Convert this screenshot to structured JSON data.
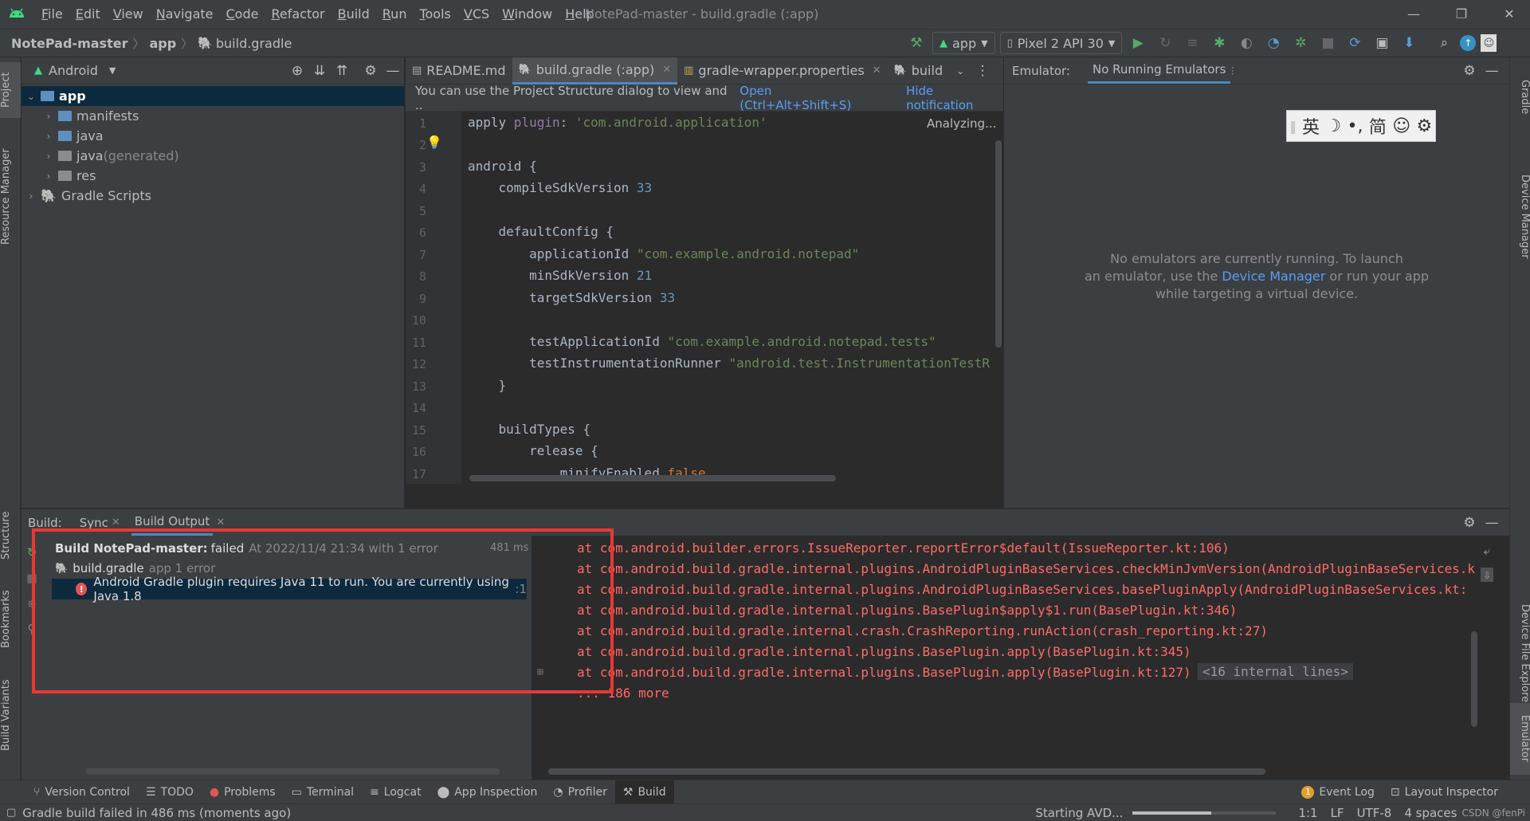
{
  "menubar": {
    "items": [
      "File",
      "Edit",
      "View",
      "Navigate",
      "Code",
      "Refactor",
      "Build",
      "Run",
      "Tools",
      "VCS",
      "Window",
      "Help"
    ],
    "window_title": "NotePad-master - build.gradle (:app)"
  },
  "navbar": {
    "breadcrumbs": [
      "NotePad-master",
      "app",
      "build.gradle"
    ],
    "run_config": "app",
    "device": "Pixel 2 API 30"
  },
  "left_stripe": {
    "project": "Project",
    "resource_manager": "Resource Manager",
    "structure": "Structure",
    "bookmarks": "Bookmarks",
    "build_variants": "Build Variants"
  },
  "right_stripe": {
    "gradle": "Gradle",
    "device_manager": "Device Manager",
    "device_file_explorer": "Device File Explorer",
    "emulator": "Emulator"
  },
  "project": {
    "view": "Android",
    "tree": [
      {
        "label": "app",
        "level": 0
      },
      {
        "label": "manifests",
        "level": 1
      },
      {
        "label": "java",
        "level": 1
      },
      {
        "label": "java",
        "suffix": " (generated)",
        "level": 1
      },
      {
        "label": "res",
        "level": 1
      },
      {
        "label": "Gradle Scripts",
        "level": 0
      }
    ]
  },
  "editor": {
    "tabs": [
      "README.md",
      "build.gradle (:app)",
      "gradle-wrapper.properties",
      "build"
    ],
    "notification": "You can use the Project Structure dialog to view and ..",
    "notification_link": "Open (Ctrl+Alt+Shift+S)",
    "hide_notification": "Hide notification",
    "analyzing": "Analyzing...",
    "line_numbers": [
      "1",
      "2",
      "3",
      "4",
      "5",
      "6",
      "7",
      "8",
      "9",
      "10",
      "11",
      "12",
      "13",
      "14",
      "15",
      "16",
      "17"
    ]
  },
  "emulator": {
    "label": "Emulator:",
    "tab": "No Running Emulators",
    "message_1": "No emulators are currently running. To launch",
    "message_2a": "an emulator, use the ",
    "message_2_link": "Device Manager",
    "message_2b": " or run your app",
    "message_3": "while targeting a virtual device.",
    "ime": [
      "英",
      "☽",
      "•,",
      "简",
      "☺",
      "⚙"
    ]
  },
  "build": {
    "label": "Build:",
    "tabs": [
      "Sync",
      "Build Output"
    ],
    "root_title": "Build NotePad-master:",
    "root_status": "failed",
    "root_meta": "At 2022/11/4 21:34 with 1 error",
    "root_time": "481 ms",
    "child_label": "build.gradle",
    "child_meta": "app 1 error",
    "error": "Android Gradle plugin requires Java 11 to run. You are currently using Java 1.8",
    "error_suffix": ":1",
    "console": [
      "at com.android.builder.errors.IssueReporter.reportError$default(IssueReporter.kt:106)",
      "at com.android.build.gradle.internal.plugins.AndroidPluginBaseServices.checkMinJvmVersion(AndroidPluginBaseServices.k",
      "at com.android.build.gradle.internal.plugins.AndroidPluginBaseServices.basePluginApply(AndroidPluginBaseServices.kt:",
      "at com.android.build.gradle.internal.plugins.BasePlugin$apply$1.run(BasePlugin.kt:346)",
      "at com.android.build.gradle.internal.crash.CrashReporting.runAction(crash_reporting.kt:27)",
      "at com.android.build.gradle.internal.plugins.BasePlugin.apply(BasePlugin.kt:345)",
      "at com.android.build.gradle.internal.plugins.BasePlugin.apply(BasePlugin.kt:127)"
    ],
    "internal_lines": "<16 internal lines>",
    "more": "... 186 more"
  },
  "bottom_tools": [
    "Version Control",
    "TODO",
    "Problems",
    "Terminal",
    "Logcat",
    "App Inspection",
    "Profiler",
    "Build"
  ],
  "bottom_right": [
    "Event Log",
    "Layout Inspector"
  ],
  "event_log_count": "1",
  "status": {
    "message": "Gradle build failed in 486 ms (moments ago)",
    "progress_label": "Starting AVD...",
    "progress": 0.55,
    "position": "1:1",
    "line_sep": "LF",
    "encoding": "UTF-8",
    "indent": "4 spaces",
    "watermark": "CSDN @fenPi"
  },
  "colors": {
    "accent": "#4a88c7",
    "error": "#ff6b68",
    "highlight_box": "#e53935",
    "selection": "#0d293e"
  }
}
